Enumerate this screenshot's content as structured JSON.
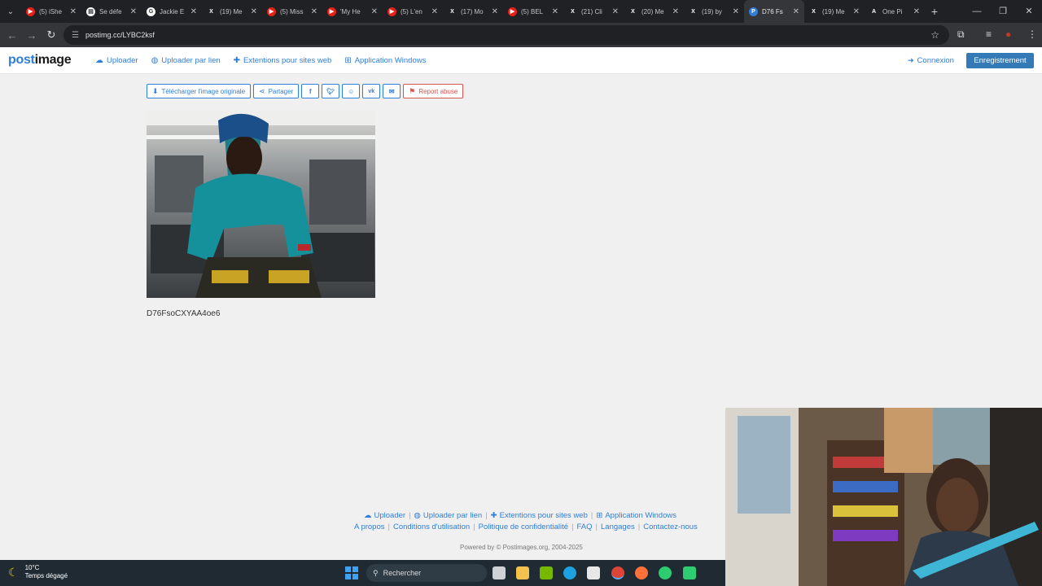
{
  "browser": {
    "tabs": [
      {
        "title": "(5) iShe",
        "color": "#e62117",
        "glyph": "▶"
      },
      {
        "title": "Se défe",
        "color": "#ffffff",
        "glyph": "▤"
      },
      {
        "title": "Jackie E",
        "color": "#ffffff",
        "glyph": "G"
      },
      {
        "title": "(19) Me",
        "color": "#202124",
        "glyph": "X"
      },
      {
        "title": "(5) Miss",
        "color": "#e62117",
        "glyph": "▶"
      },
      {
        "title": "'My He",
        "color": "#e62117",
        "glyph": "▶"
      },
      {
        "title": "(5) L'en",
        "color": "#e62117",
        "glyph": "▶"
      },
      {
        "title": "(17) Mo",
        "color": "#202124",
        "glyph": "X"
      },
      {
        "title": "(5) BEL",
        "color": "#e62117",
        "glyph": "▶"
      },
      {
        "title": "(21) Cli",
        "color": "#202124",
        "glyph": "X"
      },
      {
        "title": "(20) Me",
        "color": "#202124",
        "glyph": "X"
      },
      {
        "title": "(19) by",
        "color": "#202124",
        "glyph": "X"
      },
      {
        "title": "D76 Fs",
        "color": "#2f7ed8",
        "glyph": "P",
        "active": true
      },
      {
        "title": "(19) Me",
        "color": "#202124",
        "glyph": "X"
      },
      {
        "title": "One Pi",
        "color": "#202124",
        "glyph": "A"
      }
    ],
    "url": "postimg.cc/LYBC2ksf"
  },
  "header": {
    "logo_prefix": "post",
    "logo_suffix": "image",
    "nav": [
      {
        "label": "Uploader",
        "icon": "cloud-upload-icon",
        "glyph": "☁"
      },
      {
        "label": "Uploader par lien",
        "icon": "globe-icon",
        "glyph": "◍"
      },
      {
        "label": "Extentions pour sites web",
        "icon": "puzzle-icon",
        "glyph": "✚"
      },
      {
        "label": "Application Windows",
        "icon": "windows-icon",
        "glyph": "⊞"
      }
    ],
    "login_label": "Connexion",
    "register_label": "Enregistrement"
  },
  "toolbar": {
    "download_label": "Télécharger l'image originale",
    "share_label": "Partager",
    "report_label": "Report abuse"
  },
  "image": {
    "caption": "D76FsoCXYAA4oe6"
  },
  "footer": {
    "links": [
      {
        "label": "Uploader",
        "glyph": "☁"
      },
      {
        "label": "Uploader par lien",
        "glyph": "◍"
      },
      {
        "label": "Extentions pour sites web",
        "glyph": "✚"
      },
      {
        "label": "Application Windows",
        "glyph": "⊞"
      }
    ],
    "links2": [
      "A propos",
      "Conditions d'utilisation",
      "Politique de confidentialité",
      "FAQ",
      "Langages",
      "Contactez-nous"
    ],
    "powered": "Powered by © Postimages.org, 2004-2025"
  },
  "taskbar": {
    "temp": "10°C",
    "weather": "Temps dégagé",
    "search_label": "Rechercher"
  }
}
